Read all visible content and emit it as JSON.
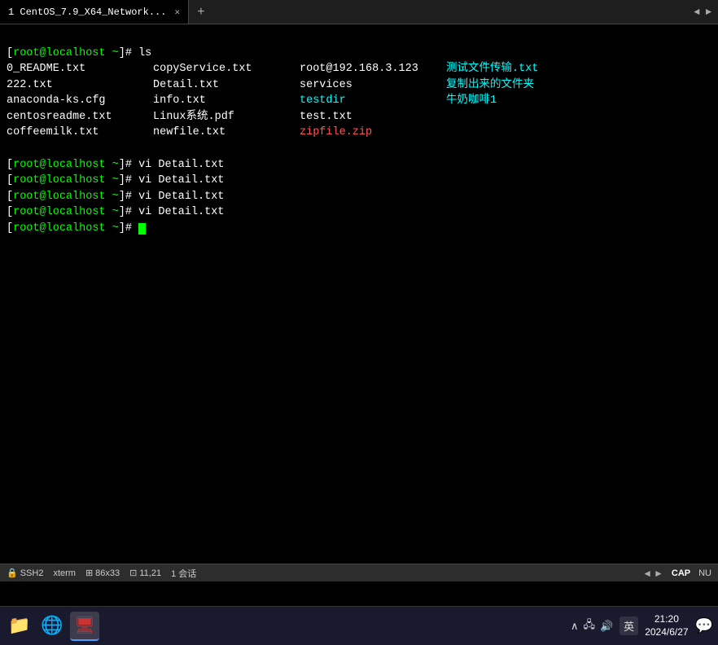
{
  "titlebar": {
    "tab_label": "1 CentOS_7.9_X64_Network...",
    "add_tab": "+",
    "nav_arrows": "◄ ►"
  },
  "terminal": {
    "prompt_user": "root",
    "prompt_at": "@",
    "prompt_host": "localhost",
    "prompt_tilde": "~",
    "prompt_hash": "#",
    "ls_command": "ls",
    "ls_files": [
      {
        "name": "0_README.txt",
        "color": "white"
      },
      {
        "name": "copyService.txt",
        "color": "white"
      },
      {
        "name": "root@192.168.3.123",
        "color": "white"
      },
      {
        "name": "测试文件传输.txt",
        "color": "cyan"
      },
      {
        "name": "222.txt",
        "color": "white"
      },
      {
        "name": "Detail.txt",
        "color": "white"
      },
      {
        "name": "services",
        "color": "white"
      },
      {
        "name": "复制出来的文件夹",
        "color": "cyan"
      },
      {
        "name": "anaconda-ks.cfg",
        "color": "white"
      },
      {
        "name": "info.txt",
        "color": "white"
      },
      {
        "name": "testdir",
        "color": "cyan"
      },
      {
        "name": "牛奶咖啡1",
        "color": "cyan"
      },
      {
        "name": "centosreadme.txt",
        "color": "white"
      },
      {
        "name": "Linux系统.pdf",
        "color": "white"
      },
      {
        "name": "test.txt",
        "color": "white"
      },
      {
        "name": "",
        "color": "white"
      },
      {
        "name": "coffeemilk.txt",
        "color": "white"
      },
      {
        "name": "newfile.txt",
        "color": "white"
      },
      {
        "name": "zipfile.zip",
        "color": "red"
      },
      {
        "name": "",
        "color": "white"
      }
    ],
    "vi_commands": [
      "vi Detail.txt",
      "vi Detail.txt",
      "vi Detail.txt",
      "vi Detail.txt"
    ],
    "cursor_color": "#00ff00"
  },
  "statusbar": {
    "ssh_label": "SSH2",
    "app_label": "xterm",
    "dimensions": "86x33",
    "position": "11,21",
    "sessions": "1 会话",
    "cap": "CAP",
    "nu": "NU",
    "nav_left": "◄",
    "nav_right": "►"
  },
  "taskbar": {
    "icons": [
      {
        "name": "file-explorer-icon",
        "symbol": "📁",
        "active": false
      },
      {
        "name": "edge-icon",
        "symbol": "🌐",
        "active": false
      },
      {
        "name": "xshell-icon",
        "symbol": "🖥",
        "active": true
      }
    ],
    "systray": {
      "chevron": "∧",
      "network": "🖧",
      "volume": "🔊",
      "lang": "英"
    },
    "clock": {
      "time": "21:20",
      "date": "2024/6/27"
    },
    "notification": "💬"
  }
}
